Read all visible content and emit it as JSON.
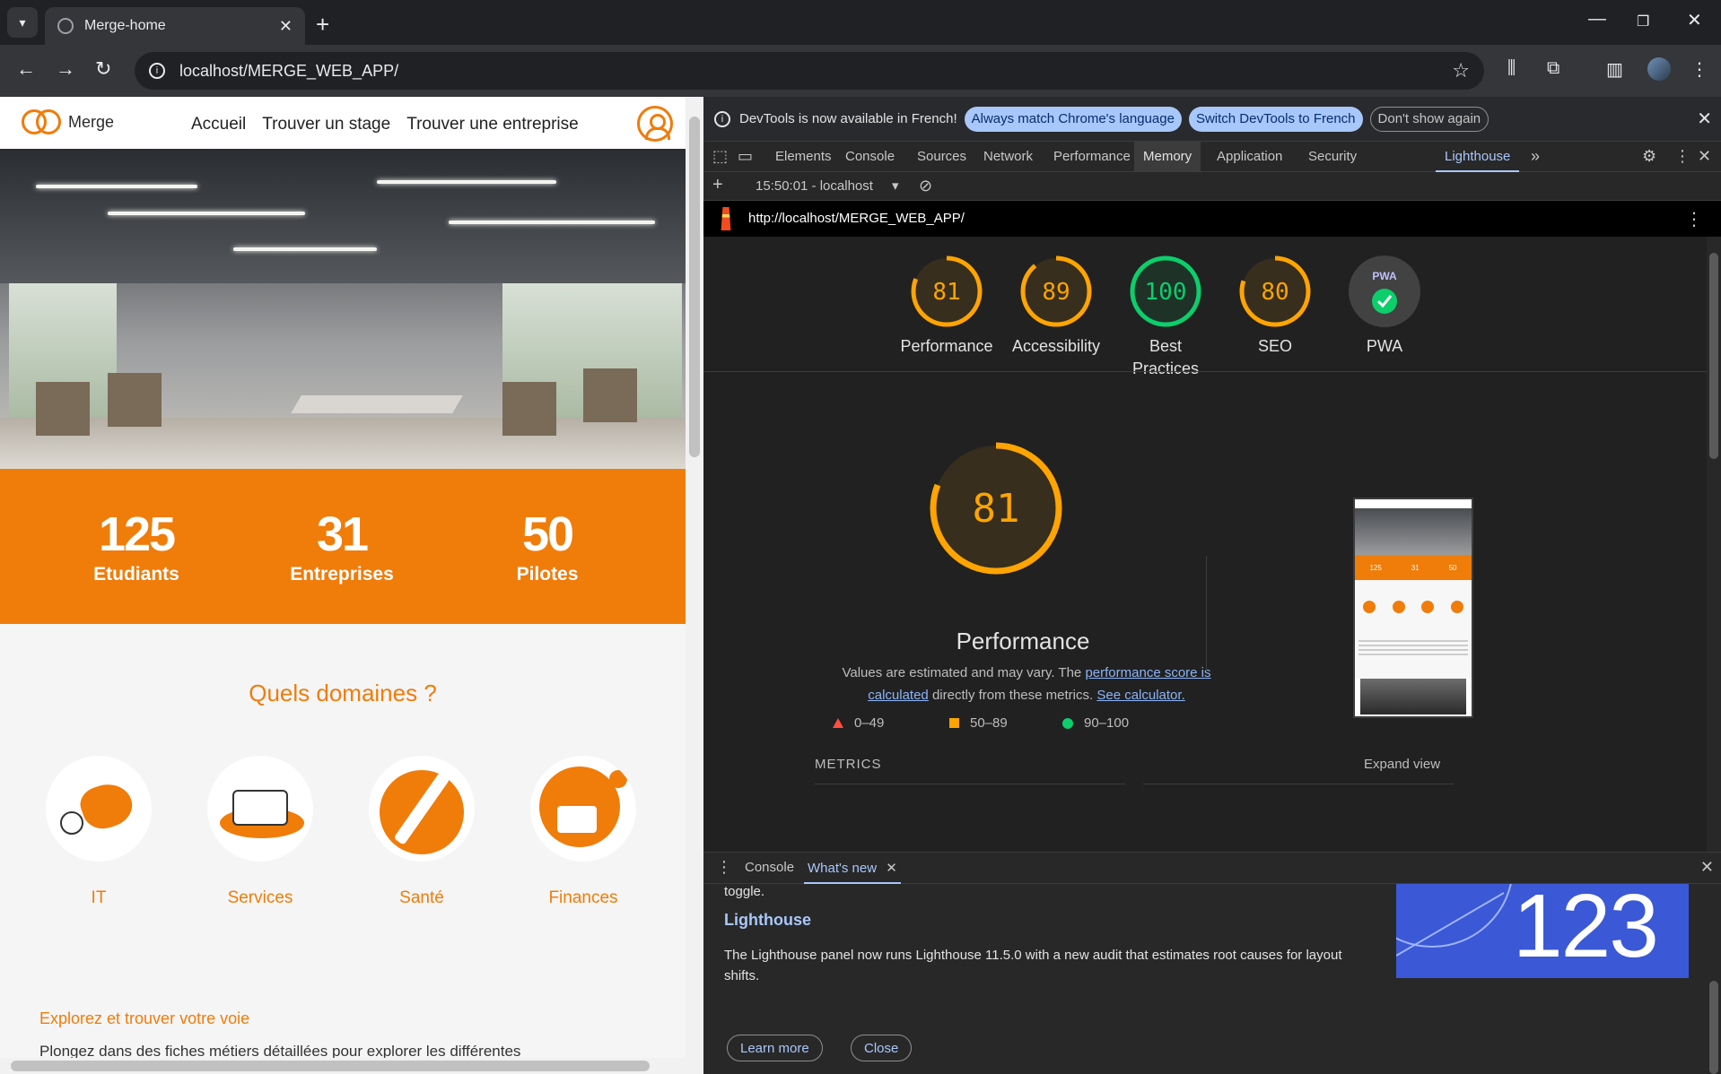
{
  "browser": {
    "tab_title": "Merge-home",
    "url": "localhost/MERGE_WEB_APP/"
  },
  "site": {
    "logo_text": "Merge",
    "nav": [
      "Accueil",
      "Trouver un stage",
      "Trouver une entreprise"
    ],
    "stats": [
      {
        "value": "125",
        "label": "Etudiants"
      },
      {
        "value": "31",
        "label": "Entreprises"
      },
      {
        "value": "50",
        "label": "Pilotes"
      }
    ],
    "domains_title": "Quels domaines ?",
    "domains": [
      "IT",
      "Services",
      "Santé",
      "Finances"
    ],
    "explore_title": "Explorez et trouver votre voie",
    "explore_text": "Plongez dans des fiches métiers détaillées pour explorer les différentes"
  },
  "devtools": {
    "infobar": {
      "message": "DevTools is now available in French!",
      "btn_match": "Always match Chrome's language",
      "btn_switch": "Switch DevTools to French",
      "btn_dont_show": "Don't show again"
    },
    "tabs": [
      "Elements",
      "Console",
      "Sources",
      "Network",
      "Performance",
      "Memory",
      "Application",
      "Security",
      "Lighthouse"
    ],
    "report_selector": "15:50:01 - localhost",
    "report_url": "http://localhost/MERGE_WEB_APP/",
    "scores": [
      {
        "value": 81,
        "label": "Performance",
        "color": "#ffa400"
      },
      {
        "value": 89,
        "label": "Accessibility",
        "color": "#ffa400"
      },
      {
        "value": 100,
        "label": "Best Practices",
        "color": "#0cce6b"
      },
      {
        "value": 80,
        "label": "SEO",
        "color": "#ffa400"
      }
    ],
    "pwa_label": "PWA",
    "pwa_badge": "PWA",
    "main_score": {
      "value": 81,
      "label": "Performance",
      "color": "#ffa400"
    },
    "perf_desc_1": "Values are estimated and may vary. The",
    "perf_desc_link1": "performance score is calculated",
    "perf_desc_2": "directly from these metrics.",
    "perf_desc_link2": "See calculator.",
    "legend": [
      "0–49",
      "50–89",
      "90–100"
    ],
    "metrics_title": "METRICS",
    "expand_view": "Expand view",
    "screenshot_stats": [
      "125",
      "31",
      "50"
    ]
  },
  "drawer": {
    "tabs": [
      "Console",
      "What's new"
    ],
    "toggle_text": "toggle.",
    "title": "Lighthouse",
    "text": "The Lighthouse panel now runs Lighthouse 11.5.0 with a new audit that estimates root causes for layout shifts.",
    "image_number": "123",
    "learn_more": "Learn more",
    "close": "Close"
  },
  "colors": {
    "brand_orange": "#f07c0a",
    "score_average": "#ffa400",
    "score_pass": "#0cce6b",
    "score_fail": "#ff4e42"
  }
}
